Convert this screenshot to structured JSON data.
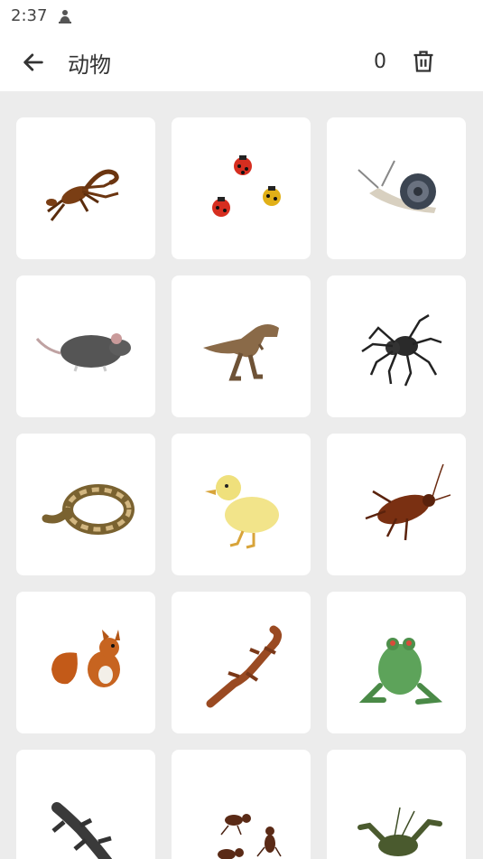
{
  "status_bar": {
    "time": "2:37"
  },
  "header": {
    "title": "动物",
    "count": "0"
  },
  "grid": {
    "items": [
      {
        "icon": "scorpion-icon"
      },
      {
        "icon": "ladybugs-icon"
      },
      {
        "icon": "snail-icon"
      },
      {
        "icon": "rat-icon"
      },
      {
        "icon": "t-rex-icon"
      },
      {
        "icon": "spider-icon"
      },
      {
        "icon": "snake-icon"
      },
      {
        "icon": "duckling-icon"
      },
      {
        "icon": "cockroach-icon"
      },
      {
        "icon": "squirrel-icon"
      },
      {
        "icon": "lizard-icon"
      },
      {
        "icon": "frog-icon"
      },
      {
        "icon": "gecko-icon"
      },
      {
        "icon": "ants-icon"
      },
      {
        "icon": "crayfish-icon"
      }
    ]
  }
}
